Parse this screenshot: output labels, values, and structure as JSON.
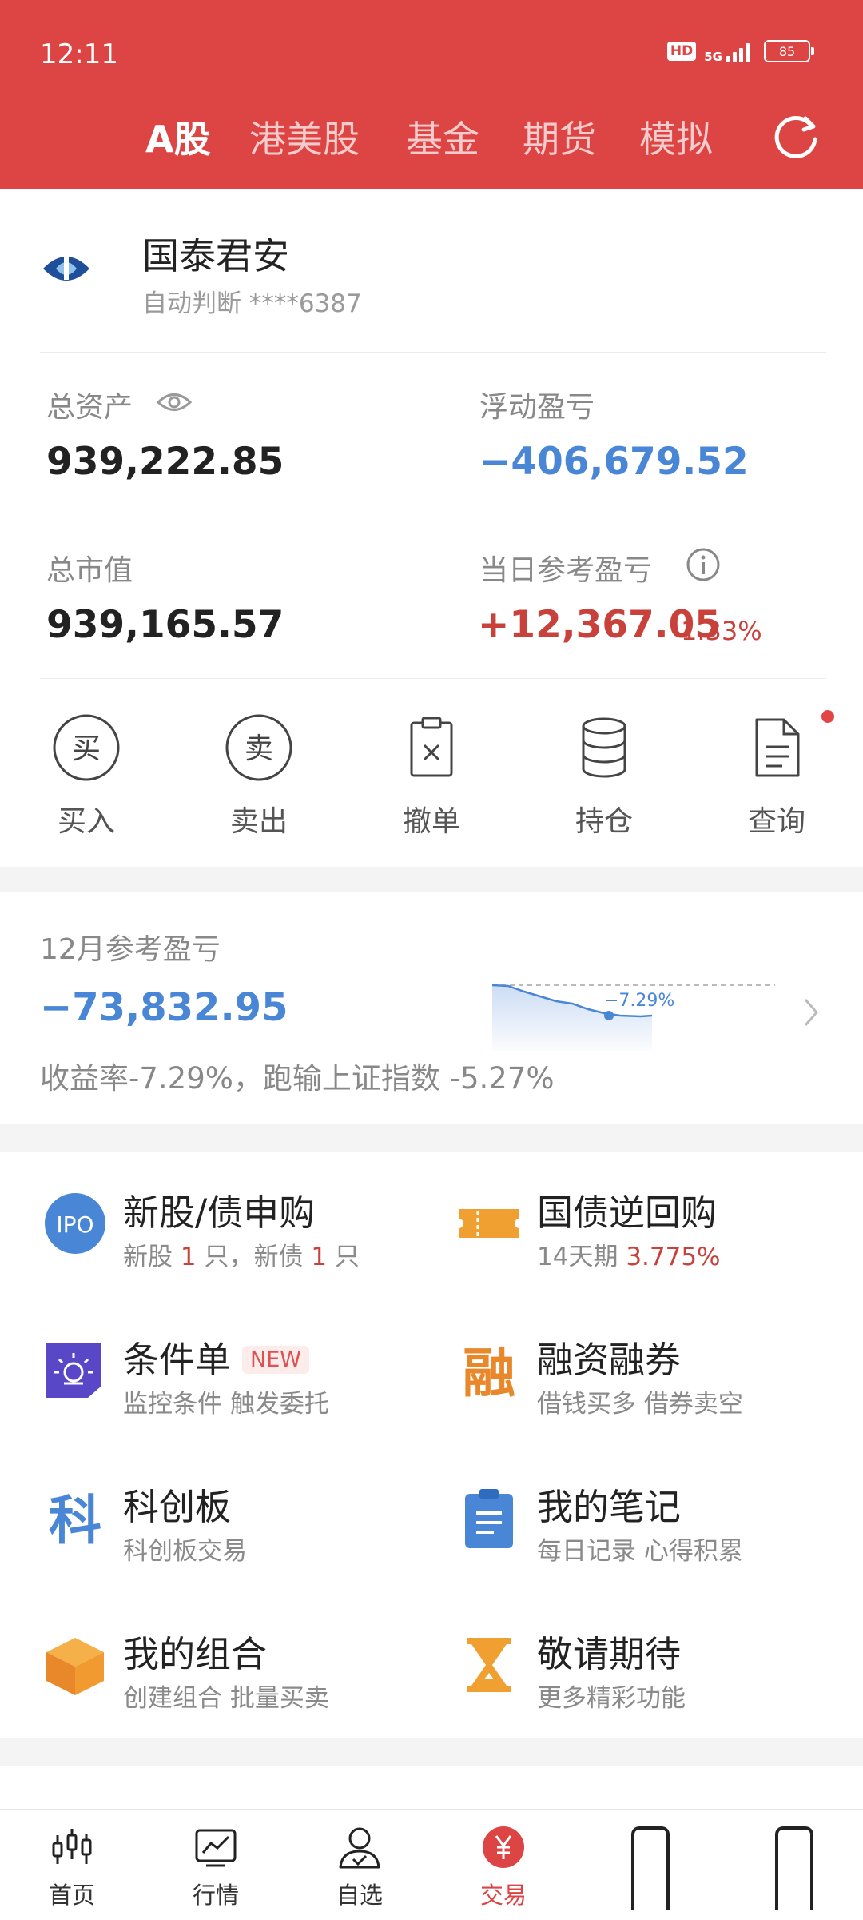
{
  "status": {
    "time": "12:11",
    "hd": "HD",
    "network": "5G",
    "battery": "85"
  },
  "tabs": [
    {
      "label": "A股",
      "active": true
    },
    {
      "label": "港美股",
      "active": false
    },
    {
      "label": "基金",
      "active": false
    },
    {
      "label": "期货",
      "active": false
    },
    {
      "label": "模拟",
      "active": false
    }
  ],
  "account": {
    "broker": "国泰君安",
    "subtitle": "自动判断 ****6387"
  },
  "summary": {
    "total_assets_label": "总资产",
    "total_assets": "939,222.85",
    "float_pnl_label": "浮动盈亏",
    "float_pnl": "−406,679.52",
    "market_value_label": "总市值",
    "market_value": "939,165.57",
    "daily_pnl_label": "当日参考盈亏",
    "daily_pnl": "+12,367.05",
    "daily_pct": "1.33%"
  },
  "actions": [
    {
      "label": "买入",
      "glyph": "买"
    },
    {
      "label": "卖出",
      "glyph": "卖"
    },
    {
      "label": "撤单"
    },
    {
      "label": "持仓"
    },
    {
      "label": "查询"
    }
  ],
  "monthly": {
    "title": "12月参考盈亏",
    "value": "−73,832.95",
    "spark_label": "−7.29%",
    "desc": "收益率-7.29%，跑输上证指数 -5.27%"
  },
  "features": [
    {
      "title": "新股/债申购",
      "sub_pre": "新股 ",
      "sub_hl1": "1",
      "sub_mid": " 只，新债 ",
      "sub_hl2": "1",
      "sub_post": " 只",
      "icon": "ipo-icon",
      "icon_text": "IPO"
    },
    {
      "title": "国债逆回购",
      "sub_pre": "14天期 ",
      "sub_hl1": "3.775%",
      "icon": "ticket-icon"
    },
    {
      "title": "条件单",
      "tag": "NEW",
      "sub": "监控条件 触发委托",
      "icon": "alarm-light-icon"
    },
    {
      "title": "融资融券",
      "sub": "借钱买多 借券卖空",
      "icon": "margin-icon",
      "icon_text": "融"
    },
    {
      "title": "科创板",
      "sub": "科创板交易",
      "icon": "star-board-icon",
      "icon_text": "科"
    },
    {
      "title": "我的笔记",
      "sub": "每日记录 心得积累",
      "icon": "clipboard-icon"
    },
    {
      "title": "我的组合",
      "sub": "创建组合 批量买卖",
      "icon": "cube-icon"
    },
    {
      "title": "敬请期待",
      "sub": "更多精彩功能",
      "icon": "hourglass-icon"
    }
  ],
  "nav": [
    {
      "label": "首页",
      "icon": "candlestick-icon"
    },
    {
      "label": "行情",
      "icon": "chart-icon"
    },
    {
      "label": "自选",
      "icon": "user-check-icon"
    },
    {
      "label": "交易",
      "icon": "yuan-icon",
      "active": true
    }
  ],
  "colors": {
    "brand_red": "#dd4444",
    "loss_blue": "#4a86d6",
    "gain_red": "#c8413b"
  }
}
